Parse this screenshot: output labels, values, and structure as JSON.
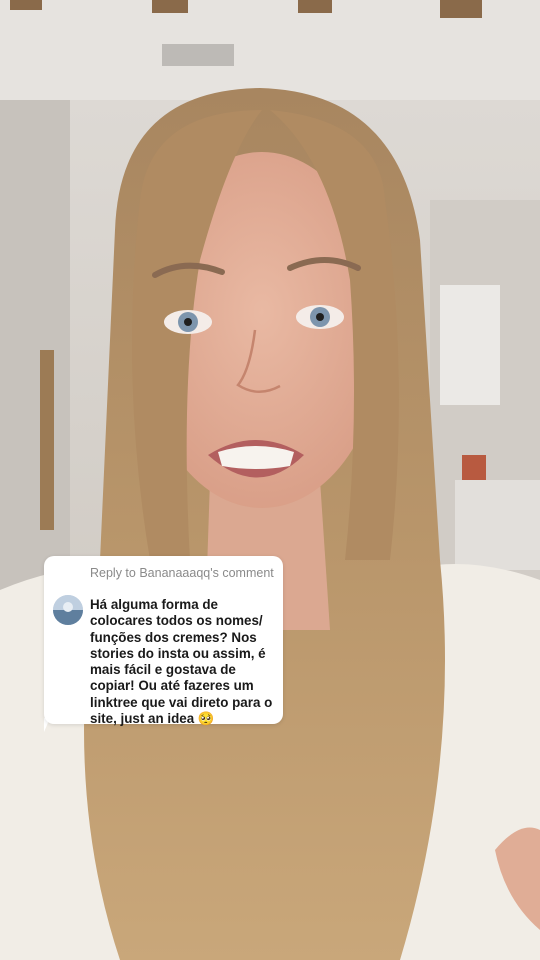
{
  "comment_card": {
    "reply_header": "Reply to Bananaaaqq's comment",
    "comment_text": "Há alguma forma de colocares todos os nomes/ funções dos cremes? Nos stories do insta ou assim, é mais fácil e gostava de copiar! Ou até fazeres um linktree que vai direto para o site, just an idea 🥺"
  }
}
